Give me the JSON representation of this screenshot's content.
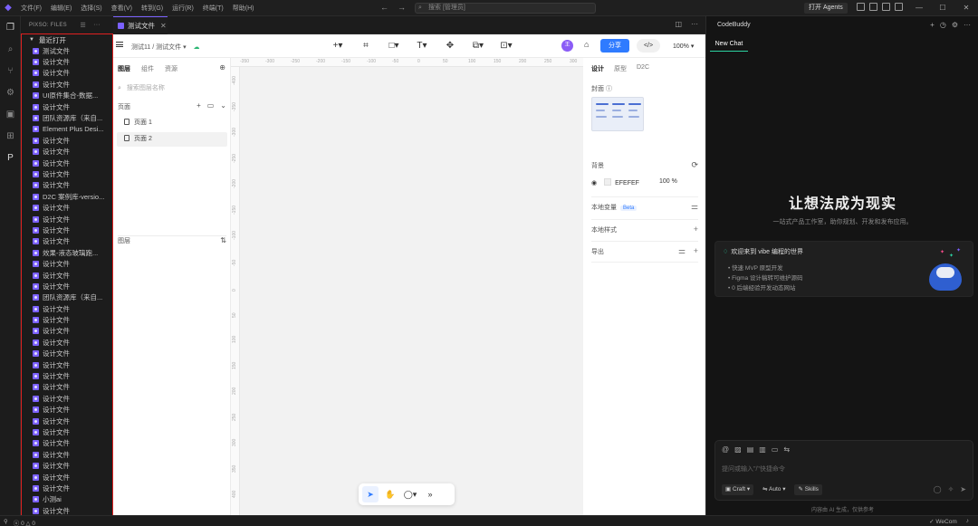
{
  "menu": [
    "文件(F)",
    "编辑(E)",
    "选择(S)",
    "查看(V)",
    "转到(G)",
    "运行(R)",
    "终端(T)",
    "帮助(H)"
  ],
  "command_search": "搜索 [管理员]",
  "agents_button": "打开 Agents",
  "explorer": {
    "header": "PIXSO: FILES",
    "section": "最近打开",
    "files": [
      "测试文件",
      "设计文件",
      "设计文件",
      "设计文件",
      "UI原件集合-数据...",
      "设计文件",
      "团队资源库（来自...",
      "Element Plus Desi...",
      "设计文件",
      "设计文件",
      "设计文件",
      "设计文件",
      "设计文件",
      "D2C 案例库-versio...",
      "设计文件",
      "设计文件",
      "设计文件",
      "设计文件",
      "效果-液态玻璃跑...",
      "设计文件",
      "设计文件",
      "设计文件",
      "团队资源库（来自...",
      "设计文件",
      "设计文件",
      "设计文件",
      "设计文件",
      "设计文件",
      "设计文件",
      "设计文件",
      "设计文件",
      "设计文件",
      "设计文件",
      "设计文件",
      "设计文件",
      "设计文件",
      "设计文件",
      "设计文件",
      "设计文件",
      "设计文件",
      "小测ai",
      "设计文件",
      "设计文件"
    ]
  },
  "editor_tab": "测试文件",
  "design": {
    "breadcrumb": "测试11 / 测试文件",
    "share": "分享",
    "zoom": "100%",
    "avatar": "王",
    "left_tabs": [
      "图层",
      "组件",
      "资源"
    ],
    "layer_search_placeholder": "搜索图层名称",
    "pages_label": "页面",
    "pages": [
      "页面 1",
      "页面 2"
    ],
    "layers_label": "图层",
    "ruler_x": [
      "-350",
      "-300",
      "-250",
      "-200",
      "-150",
      "-100",
      "-50",
      "0",
      "50",
      "100",
      "150",
      "200",
      "250",
      "300"
    ],
    "ruler_y": [
      "-400",
      "-350",
      "-300",
      "-250",
      "-200",
      "-150",
      "-100",
      "-50",
      "0",
      "50",
      "100",
      "150",
      "200",
      "250",
      "300",
      "350",
      "400"
    ],
    "right_tabs": [
      "设计",
      "原型",
      "D2C"
    ],
    "cover_label": "封面",
    "background_label": "背景",
    "bg_hex": "EFEFEF",
    "bg_opacity": "100",
    "bg_opacity_unit": "%",
    "local_vars": "本地变量",
    "beta": "Beta",
    "local_styles": "本地样式",
    "export": "导出"
  },
  "chat": {
    "title": "CodeBuddy",
    "tab": "New Chat",
    "hero": "让想法成为现实",
    "subtitle": "一站式产品工作室，助你规划、开发和发布应用。",
    "card_title": "欢迎来到 vibe 编程的世界",
    "card_items": [
      "快速 MVP 原型开发",
      "Figma 设计稿转可维护源码",
      "0 后端经验开发动态网站"
    ],
    "input_placeholder": "提问或输入\"/\"快捷命令",
    "chips": [
      "Craft",
      "Auto",
      "Skills"
    ],
    "disclaimer": "内容由 AI 生成，仅供参考"
  },
  "status": {
    "errors": "0",
    "warnings": "0",
    "right": "WeCom"
  },
  "colors": {
    "accent": "#7b61ff",
    "share": "#2f7bff",
    "highlight": "#e02020"
  }
}
